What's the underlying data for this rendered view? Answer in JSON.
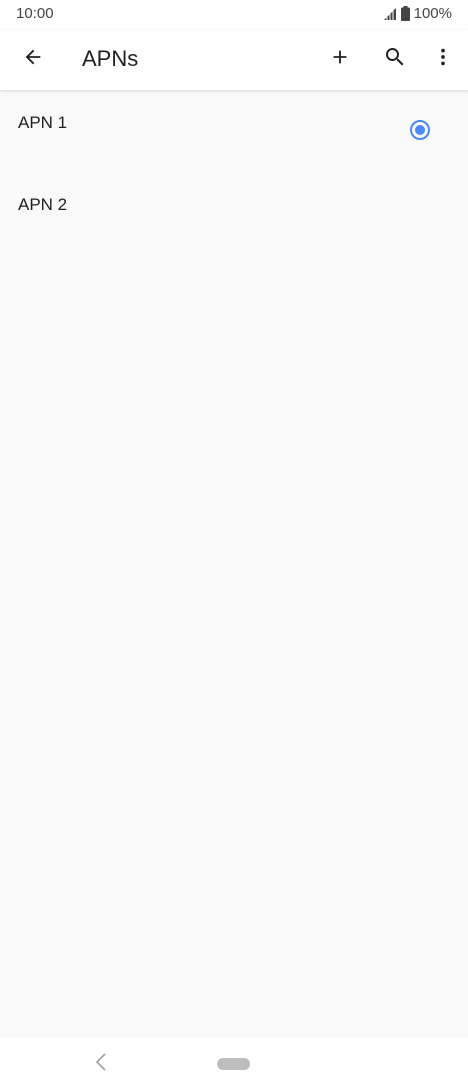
{
  "status_bar": {
    "time": "10:00",
    "battery": "100%",
    "icons": [
      "signal-icon",
      "battery-icon"
    ]
  },
  "app_bar": {
    "title": "APNs",
    "icons": [
      "back-arrow-icon",
      "add-icon",
      "search-icon",
      "more-vert-icon"
    ]
  },
  "apn_list": {
    "items": [
      {
        "label": "APN 1",
        "selected": true
      },
      {
        "label": "APN 2",
        "selected": false
      }
    ]
  },
  "colors": {
    "accent": "#4a8af4",
    "background": "#f9f9f9",
    "bar": "#ffffff"
  },
  "nav_bar": {
    "icons": [
      "nav-back-icon",
      "home-pill-icon"
    ]
  }
}
